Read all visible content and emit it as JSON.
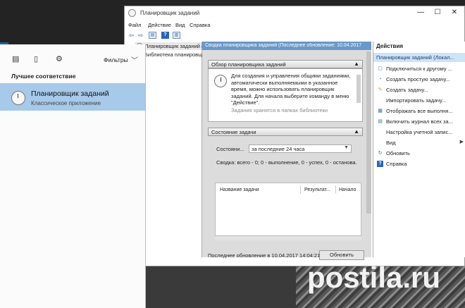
{
  "background": {
    "watermark": "postila.ru"
  },
  "scheduler": {
    "title": "Планировщик заданий",
    "window_buttons": {
      "minimize": "—",
      "maximize": "☐",
      "close": "✕"
    },
    "menu": [
      "Файл",
      "Действие",
      "Вид",
      "Справка"
    ],
    "tree": {
      "items": [
        "Планировщик заданий (Лок",
        "Библиотека планировщ"
      ]
    },
    "center": {
      "header": "Сводка планировщика заданий (Последнее обновление: 10.04.2017",
      "overview": {
        "title": "Обзор планировщика заданий",
        "text": "Для создания и управления общими заданиями, автоматически выполняемыми в указанное время, можно использовать планировщик заданий. Для начала выберите команду в меню \"Действие\".",
        "more": "Задания хранятся в папках библиотеки"
      },
      "status": {
        "title": "Состояние задачи",
        "state_label": "Состояни...",
        "period_value": "за последние 24 часа",
        "summary": "Сводка: всего - 0; 0 - выполнение, 0 - успех, 0 - останова...",
        "columns": [
          "Название задачи",
          "Результат...",
          "Начало"
        ]
      },
      "footer": {
        "last_update": "Последнее обновление в 10.04.2017 14:04:21",
        "refresh_button": "Обновить"
      }
    },
    "actions": {
      "title": "Действия",
      "subheader": "Планировщик заданий (Локал...",
      "items": [
        {
          "label": "Подключиться к другому ...",
          "icon": "connect-icon"
        },
        {
          "label": "Создать простую задачу...",
          "icon": "basic-task-icon"
        },
        {
          "label": "Создать задачу...",
          "icon": "task-icon"
        },
        {
          "label": "Импортировать задачу...",
          "icon": "import-icon"
        },
        {
          "label": "Отображать все выполня...",
          "icon": "running-tasks-icon"
        },
        {
          "label": "Включить журнал всех за...",
          "icon": "history-icon"
        },
        {
          "label": "Настройка учетной запис...",
          "icon": ""
        },
        {
          "label": "Вид",
          "icon": "",
          "submenu": "▶"
        },
        {
          "label": "Обновить",
          "icon": "refresh-icon"
        },
        {
          "label": "Справка",
          "icon": "help-icon"
        }
      ]
    }
  },
  "start_menu": {
    "top_icons": [
      "apps-icon",
      "document-icon",
      "settings-icon"
    ],
    "filters_label": "Фильтры",
    "best_match_label": "Лучшее соответствие",
    "result": {
      "title": "Планировщик заданий",
      "subtitle": "Классическое приложение",
      "icon": "clock-icon"
    }
  }
}
